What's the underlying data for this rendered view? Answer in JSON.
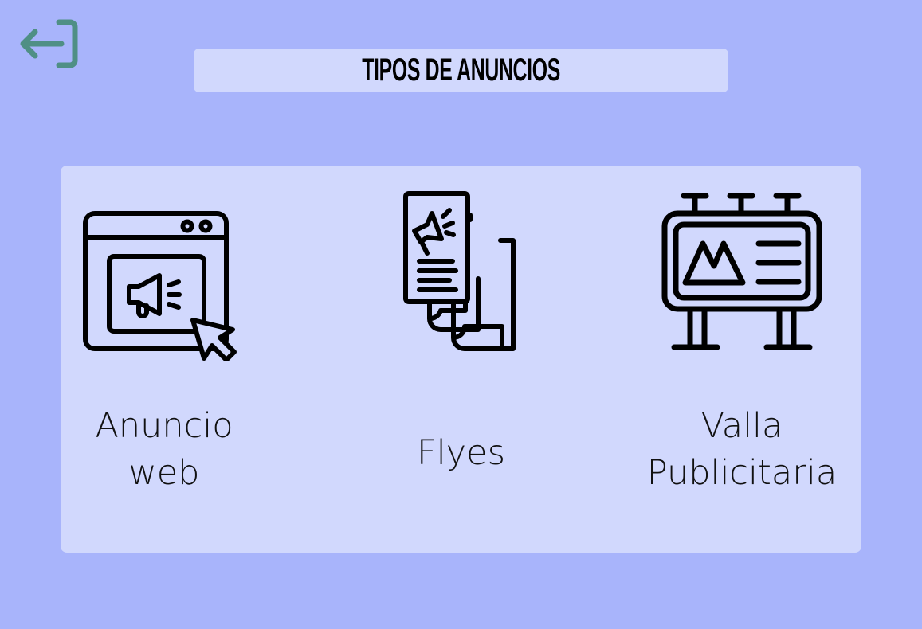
{
  "header": {
    "title": "TIPOS DE ANUNCIOS",
    "back_icon": "sign-out-arrow-left-icon"
  },
  "colors": {
    "background": "#a8b4fb",
    "panel": "#d1d8fd",
    "back_icon": "#4f8f85",
    "icon_stroke": "#000000"
  },
  "cards": [
    {
      "label": "Anuncio\nweb",
      "icon": "web-ad-megaphone-browser-icon"
    },
    {
      "label": "Flyes",
      "icon": "flyers-megaphone-icon"
    },
    {
      "label": "Valla\nPublicitaria",
      "icon": "billboard-icon"
    }
  ]
}
